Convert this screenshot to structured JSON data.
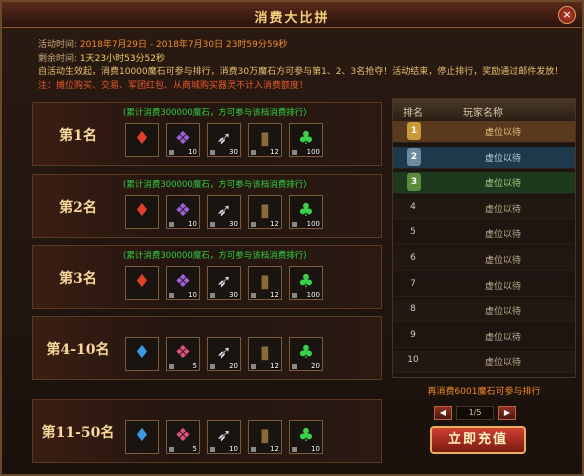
{
  "title": "消费大比拼",
  "info": {
    "activity_label": "活动时间:",
    "activity_start": "2018年7月29日",
    "dash": "-",
    "activity_end": "2018年7月30日",
    "activity_remaining": "23时59分59秒",
    "remaining_label": "剩余时间:",
    "remaining_value": "1天23小时53分52秒",
    "desc": "自活动生效起，消费10000魔石可参与排行，消费30万魔石方可参与第1、2、3名抢夺！活动结束，停止排行，奖励通过邮件发放！",
    "note": "注：摊位购买、交易、军团红包、从商城购买器灵不计入消费额度！"
  },
  "ranks": [
    {
      "label": "第1名",
      "note": "(累计消费300000魔石，方可参与该档消费排行)",
      "items": [
        {
          "icon": "red-flame-icon",
          "count": "",
          "color": "#e0402a"
        },
        {
          "icon": "purple-potion-icon",
          "count": "10",
          "color": "#a060e0"
        },
        {
          "icon": "white-feather-icon",
          "count": "30",
          "color": "#e0e0f0"
        },
        {
          "icon": "rune-book-icon",
          "count": "12",
          "color": "#8a6a3a"
        },
        {
          "icon": "clover-icon",
          "count": "100",
          "color": "#3ad04a"
        }
      ]
    },
    {
      "label": "第2名",
      "note": "(累计消费300000魔石，方可参与该档消费排行)",
      "items": [
        {
          "icon": "red-flame-icon",
          "count": "",
          "color": "#e0402a"
        },
        {
          "icon": "purple-potion-icon",
          "count": "10",
          "color": "#a060e0"
        },
        {
          "icon": "white-feather-icon",
          "count": "30",
          "color": "#e0e0f0"
        },
        {
          "icon": "rune-book-icon",
          "count": "12",
          "color": "#8a6a3a"
        },
        {
          "icon": "clover-icon",
          "count": "100",
          "color": "#3ad04a"
        }
      ]
    },
    {
      "label": "第3名",
      "note": "(累计消费300000魔石，方可参与该档消费排行)",
      "items": [
        {
          "icon": "red-flame-icon",
          "count": "",
          "color": "#e0402a"
        },
        {
          "icon": "purple-potion-icon",
          "count": "10",
          "color": "#a060e0"
        },
        {
          "icon": "white-feather-icon",
          "count": "30",
          "color": "#e0e0f0"
        },
        {
          "icon": "rune-book-icon",
          "count": "12",
          "color": "#8a6a3a"
        },
        {
          "icon": "clover-icon",
          "count": "100",
          "color": "#3ad04a"
        }
      ]
    },
    {
      "label": "第4-10名",
      "note": "",
      "items": [
        {
          "icon": "blue-flame-icon",
          "count": "",
          "color": "#3a9ae0"
        },
        {
          "icon": "pink-potion-icon",
          "count": "5",
          "color": "#e05080"
        },
        {
          "icon": "white-feather-icon",
          "count": "20",
          "color": "#e0e0f0"
        },
        {
          "icon": "rune-book-icon",
          "count": "12",
          "color": "#8a6a3a"
        },
        {
          "icon": "clover-icon",
          "count": "20",
          "color": "#3ad04a"
        }
      ]
    },
    {
      "label": "第11-50名",
      "note": "",
      "items": [
        {
          "icon": "blue-flame-icon",
          "count": "",
          "color": "#3a9ae0"
        },
        {
          "icon": "pink-potion-icon",
          "count": "5",
          "color": "#e05080"
        },
        {
          "icon": "white-feather-icon",
          "count": "10",
          "color": "#e0e0f0"
        },
        {
          "icon": "rune-book-icon",
          "count": "12",
          "color": "#8a6a3a"
        },
        {
          "icon": "clover-icon",
          "count": "10",
          "color": "#3ad04a"
        }
      ]
    }
  ],
  "board": {
    "col_rank": "排名",
    "col_name": "玩家名称",
    "rows": [
      {
        "num": "1",
        "name": "虚位以待",
        "bg": "#5a3a1c",
        "medal": "#c89a3a",
        "name_color": "#e8c080"
      },
      {
        "num": "2",
        "name": "虚位以待",
        "bg": "#1e3a4a",
        "medal": "#6a8aa0",
        "name_color": "#b0d0e0"
      },
      {
        "num": "3",
        "name": "虚位以待",
        "bg": "#1e3a1e",
        "medal": "#5a8a3a",
        "name_color": "#a0d080"
      },
      {
        "num": "4",
        "name": "虚位以待"
      },
      {
        "num": "5",
        "name": "虚位以待"
      },
      {
        "num": "6",
        "name": "虚位以待"
      },
      {
        "num": "7",
        "name": "虚位以待"
      },
      {
        "num": "8",
        "name": "虚位以待"
      },
      {
        "num": "9",
        "name": "虚位以待"
      },
      {
        "num": "10",
        "name": "虚位以待"
      }
    ]
  },
  "hint": "再消费6001魔石可参与排行",
  "pager": {
    "text": "1/5",
    "prev": "◀",
    "next": "▶"
  },
  "recharge_label": "立即充值",
  "close_label": "×"
}
